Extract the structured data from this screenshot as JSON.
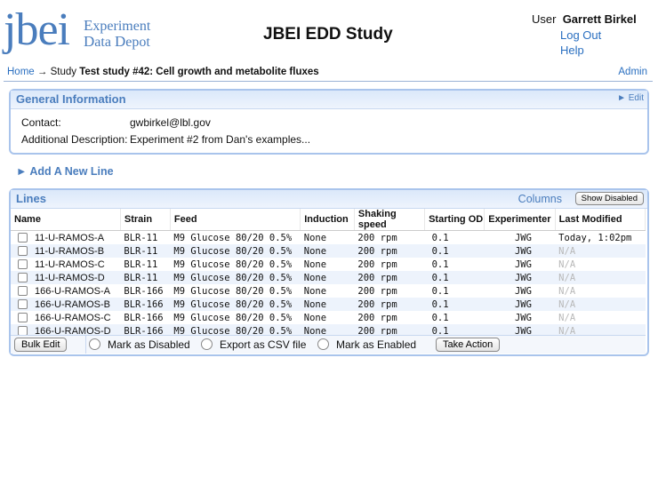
{
  "header": {
    "logo_text": "jbei",
    "logo_line1_cap": "E",
    "logo_line1_rest": "xperiment",
    "logo_line2_cap1": "D",
    "logo_line2_rest1": "ata ",
    "logo_line2_cap2": "D",
    "logo_line2_rest2": "epot",
    "title": "JBEI EDD Study",
    "user_label": "User",
    "user_name": "Garrett Birkel",
    "logout": "Log Out",
    "help": "Help"
  },
  "breadcrumb": {
    "home": "Home",
    "arrow": "→",
    "study_label": "Study",
    "study_name": "Test study #42: Cell growth and metabolite fluxes",
    "admin": "Admin"
  },
  "general": {
    "title": "General Information",
    "edit": "► Edit",
    "contact_label": "Contact:",
    "contact_value": "gwbirkel@lbl.gov",
    "desc_label": "Additional Description:",
    "desc_value": "Experiment #2 from Dan's examples..."
  },
  "add_line": "► Add A New Line",
  "lines": {
    "title": "Lines",
    "columns_link": "Columns",
    "show_disabled": "Show Disabled",
    "headers": [
      "Name",
      "Strain",
      "Feed",
      "Induction",
      "Shaking speed",
      "Starting OD",
      "Experimenter",
      "Last Modified"
    ],
    "rows": [
      [
        "11-U-RAMOS-A",
        "BLR-11",
        "M9 Glucose 80/20 0.5%",
        "None",
        "200 rpm",
        "0.1",
        "JWG",
        "Today, 1:02pm"
      ],
      [
        "11-U-RAMOS-B",
        "BLR-11",
        "M9 Glucose 80/20 0.5%",
        "None",
        "200 rpm",
        "0.1",
        "JWG",
        "N/A"
      ],
      [
        "11-U-RAMOS-C",
        "BLR-11",
        "M9 Glucose 80/20 0.5%",
        "None",
        "200 rpm",
        "0.1",
        "JWG",
        "N/A"
      ],
      [
        "11-U-RAMOS-D",
        "BLR-11",
        "M9 Glucose 80/20 0.5%",
        "None",
        "200 rpm",
        "0.1",
        "JWG",
        "N/A"
      ],
      [
        "166-U-RAMOS-A",
        "BLR-166",
        "M9 Glucose 80/20 0.5%",
        "None",
        "200 rpm",
        "0.1",
        "JWG",
        "N/A"
      ],
      [
        "166-U-RAMOS-B",
        "BLR-166",
        "M9 Glucose 80/20 0.5%",
        "None",
        "200 rpm",
        "0.1",
        "JWG",
        "N/A"
      ],
      [
        "166-U-RAMOS-C",
        "BLR-166",
        "M9 Glucose 80/20 0.5%",
        "None",
        "200 rpm",
        "0.1",
        "JWG",
        "N/A"
      ],
      [
        "166-U-RAMOS-D",
        "BLR-166",
        "M9 Glucose 80/20 0.5%",
        "None",
        "200 rpm",
        "0.1",
        "JWG",
        "N/A"
      ]
    ],
    "actions": {
      "bulk_edit": "Bulk Edit",
      "mark_disabled": "Mark as Disabled",
      "export_csv": "Export as CSV file",
      "mark_enabled": "Mark as Enabled",
      "take_action": "Take Action"
    }
  }
}
